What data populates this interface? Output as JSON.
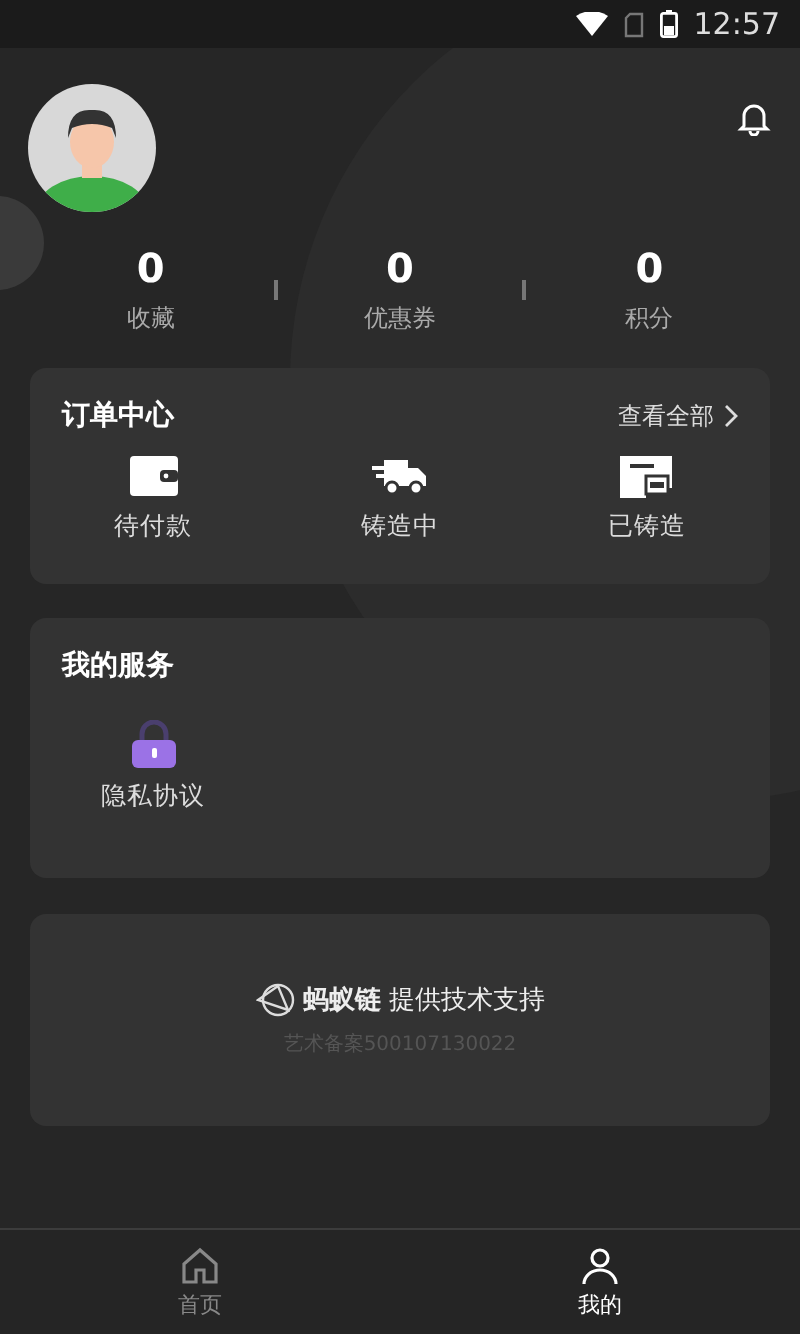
{
  "status_bar": {
    "time": "12:57"
  },
  "profile": {
    "stats": [
      {
        "value": "0",
        "label": "收藏"
      },
      {
        "value": "0",
        "label": "优惠券"
      },
      {
        "value": "0",
        "label": "积分"
      }
    ]
  },
  "orders": {
    "title": "订单中心",
    "view_all": "查看全部",
    "items": [
      {
        "kind": "wallet",
        "label": "待付款"
      },
      {
        "kind": "truck",
        "label": "铸造中"
      },
      {
        "kind": "card",
        "label": "已铸造"
      }
    ]
  },
  "services": {
    "title": "我的服务",
    "items": [
      {
        "kind": "lock",
        "label": "隐私协议"
      }
    ]
  },
  "footer": {
    "brand": "蚂蚁链",
    "text": "提供技术支持",
    "record": "艺术备案500107130022"
  },
  "tabs": [
    {
      "kind": "home",
      "label": "首页",
      "selected": false
    },
    {
      "kind": "user",
      "label": "我的",
      "selected": true
    }
  ]
}
